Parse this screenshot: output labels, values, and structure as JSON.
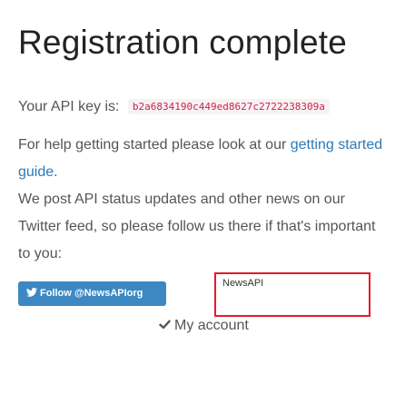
{
  "page": {
    "title": "Registration complete"
  },
  "api": {
    "label": "Your API key is:",
    "key": "b2a6834190c449ed8627c2722238309a"
  },
  "help": {
    "text_before": "For help getting started please look at our ",
    "link_text": "getting started guide",
    "text_after": "."
  },
  "news": {
    "text": "We post API status updates and other news on our Twitter feed, so please follow us there if that's important to you:"
  },
  "follow_button": {
    "icon": "twitter-icon",
    "label": "Follow @NewsAPIorg"
  },
  "news_frame": {
    "label": "NewsAPI"
  },
  "account_button": {
    "icon": "check-icon",
    "label": "My account"
  },
  "colors": {
    "link": "#2a7ab8",
    "api_key": "#c7254e",
    "follow_button_bg": "#3b88c3",
    "frame_border": "#e8192c",
    "check": "#555555"
  }
}
